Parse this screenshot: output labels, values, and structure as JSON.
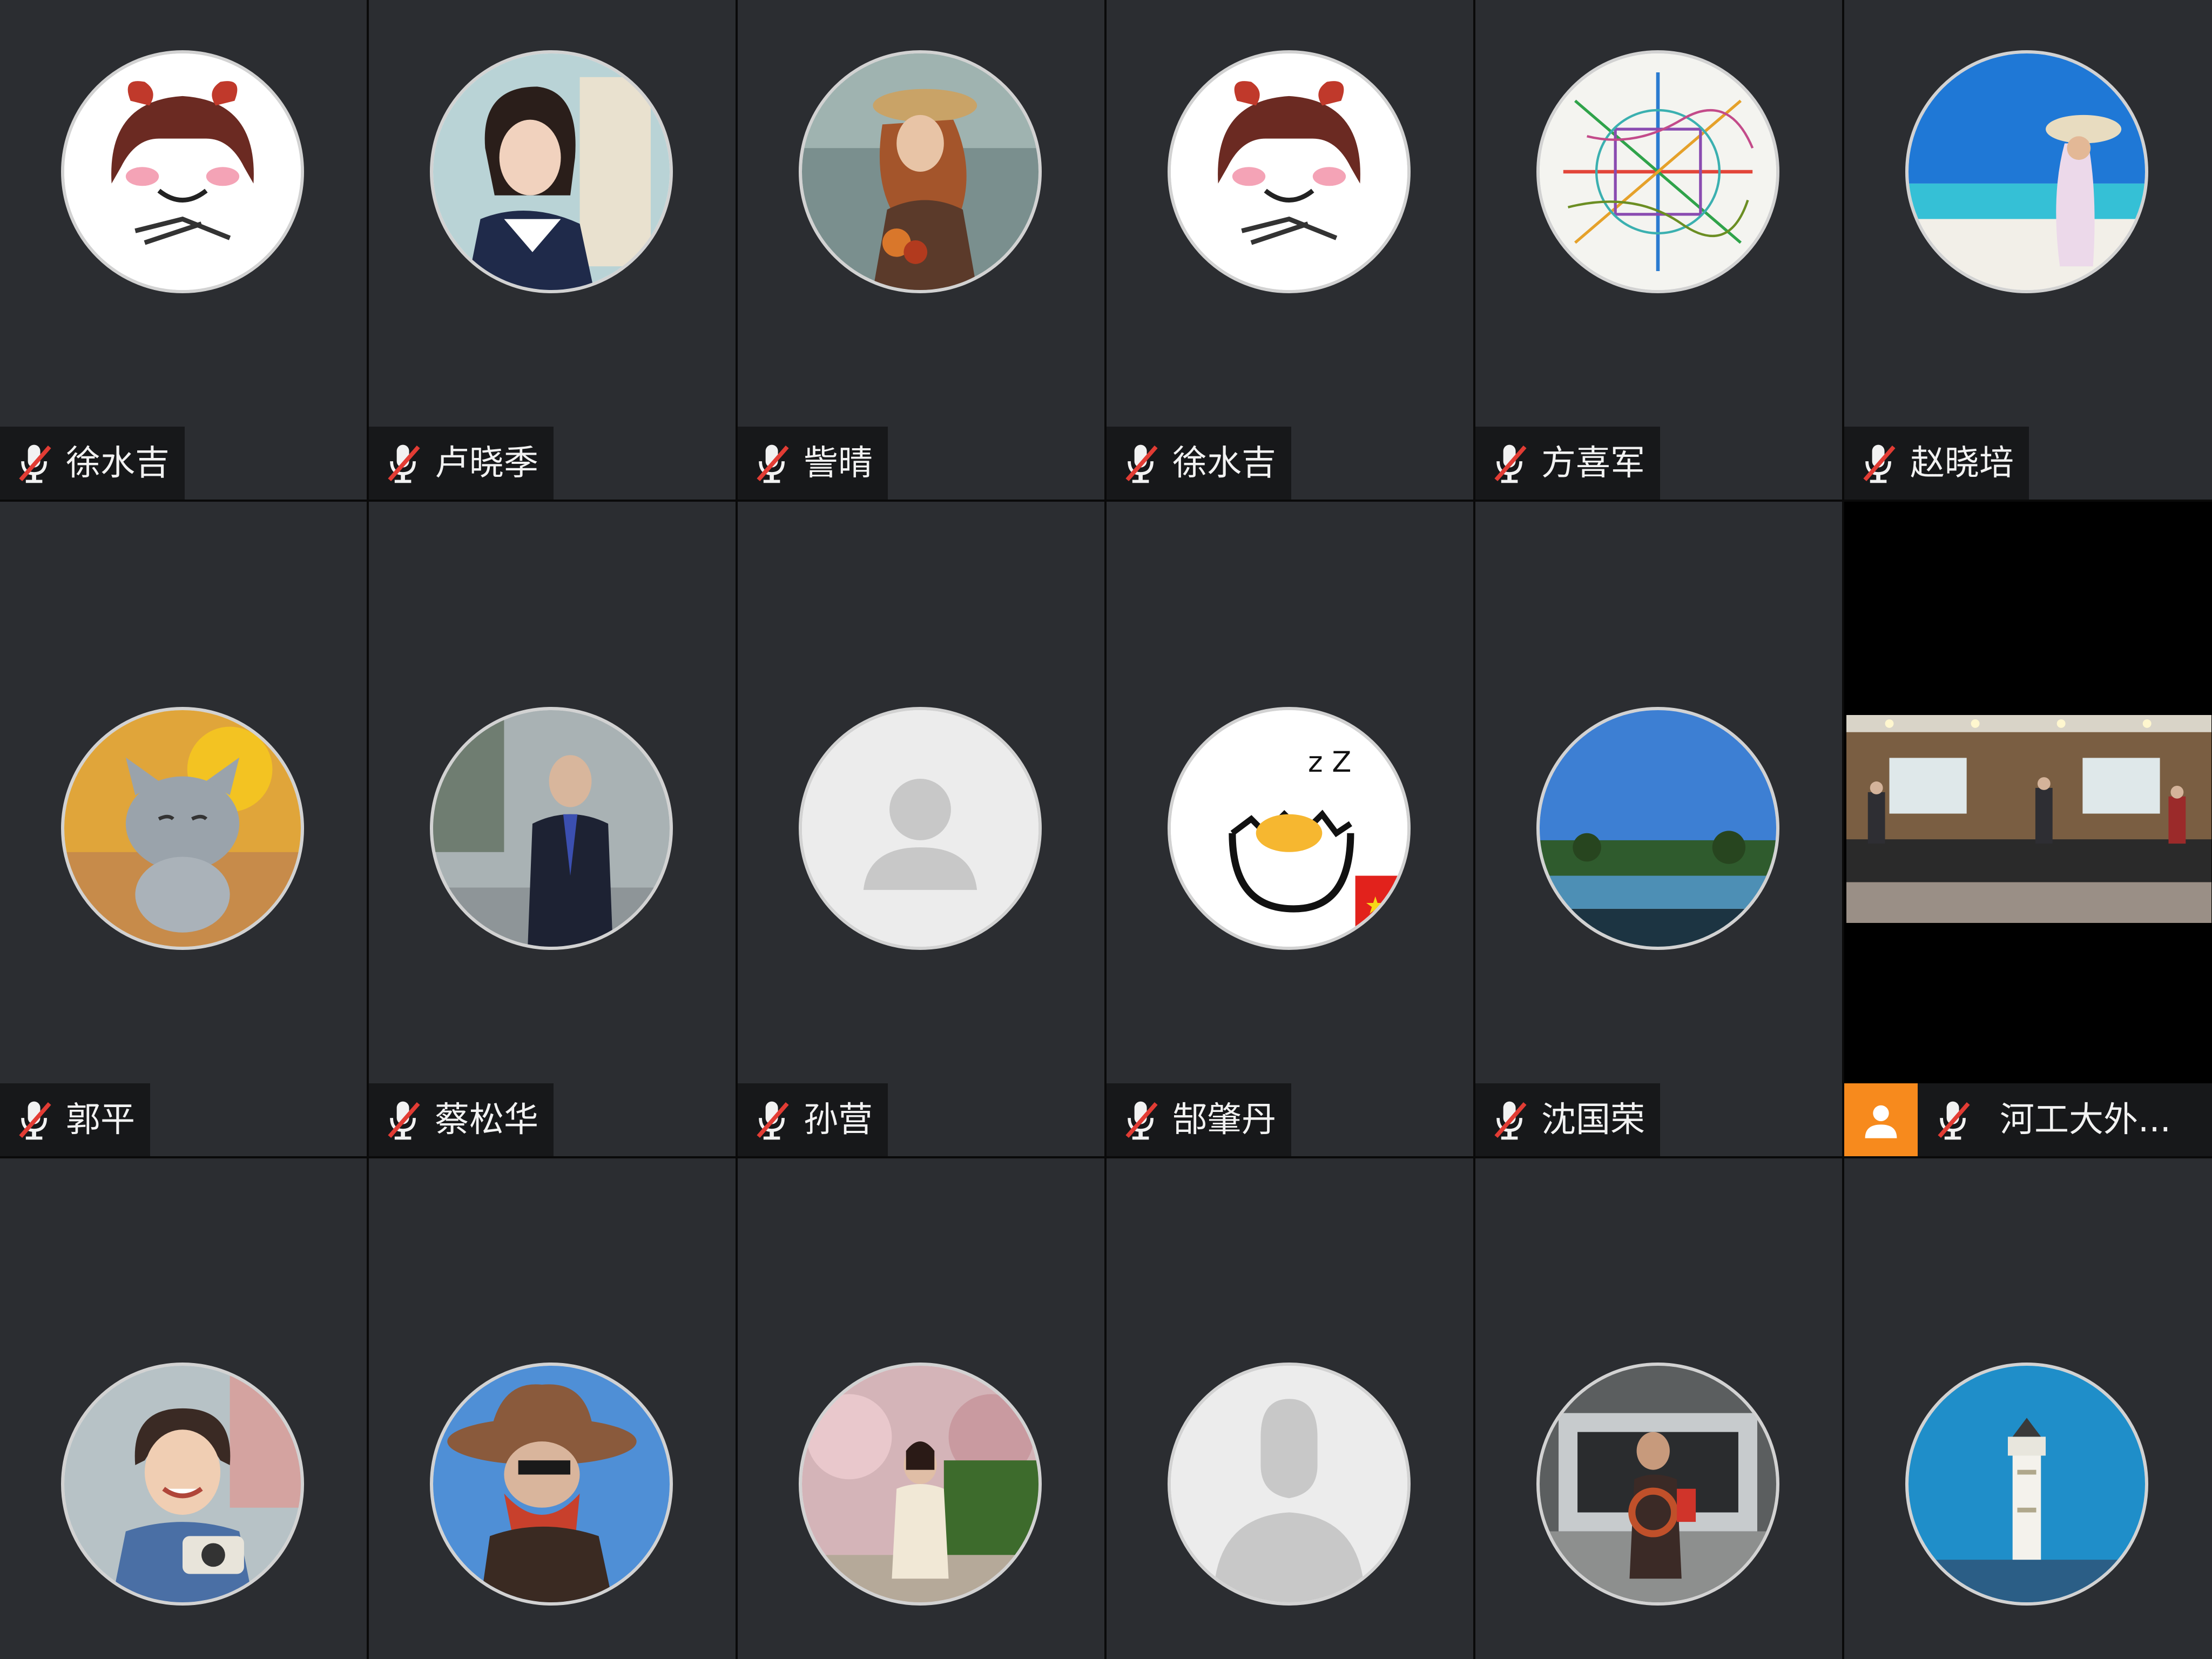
{
  "meeting": {
    "participants": [
      {
        "name": "徐水吉",
        "mic": "muted",
        "avatar": "cartoon-girl-avatar"
      },
      {
        "name": "卢晓季",
        "mic": "muted",
        "avatar": "girl-photo-avatar"
      },
      {
        "name": "訾晴",
        "mic": "muted",
        "avatar": "painting-avatar"
      },
      {
        "name": "徐水吉",
        "mic": "muted",
        "avatar": "cartoon-girl-avatar"
      },
      {
        "name": "方喜军",
        "mic": "muted",
        "avatar": "subway-map-avatar"
      },
      {
        "name": "赵晓培",
        "mic": "muted",
        "avatar": "beach-avatar"
      },
      {
        "name": "郭平",
        "mic": "muted",
        "avatar": "cat-figurine-avatar"
      },
      {
        "name": "蔡松华",
        "mic": "muted",
        "avatar": "man-in-suit-avatar"
      },
      {
        "name": "孙营",
        "mic": "muted",
        "avatar": "default-person-avatar"
      },
      {
        "name": "郜肇丹",
        "mic": "muted",
        "avatar": "egg-cartoon-avatar"
      },
      {
        "name": "沈国荣",
        "mic": "muted",
        "avatar": "landscape-avatar"
      },
      {
        "name": "河工大外...",
        "mic": "muted",
        "video": "conference-room-video",
        "host": true
      },
      {
        "name": "",
        "mic": "",
        "avatar": "child-photo-avatar"
      },
      {
        "name": "",
        "mic": "",
        "avatar": "cowboy-avatar"
      },
      {
        "name": "",
        "mic": "",
        "avatar": "woman-park-avatar"
      },
      {
        "name": "",
        "mic": "",
        "avatar": "default-silhouette-avatar"
      },
      {
        "name": "",
        "mic": "",
        "avatar": "car-trunk-avatar"
      },
      {
        "name": "",
        "mic": "",
        "avatar": "lighthouse-avatar"
      }
    ]
  },
  "colors": {
    "tile_bg": "#2b2d31",
    "separator": "#0a0a0a",
    "nameplate_bg": "#17181a",
    "muted_icon": "#e23c34",
    "host_badge": "#f78a1d"
  }
}
